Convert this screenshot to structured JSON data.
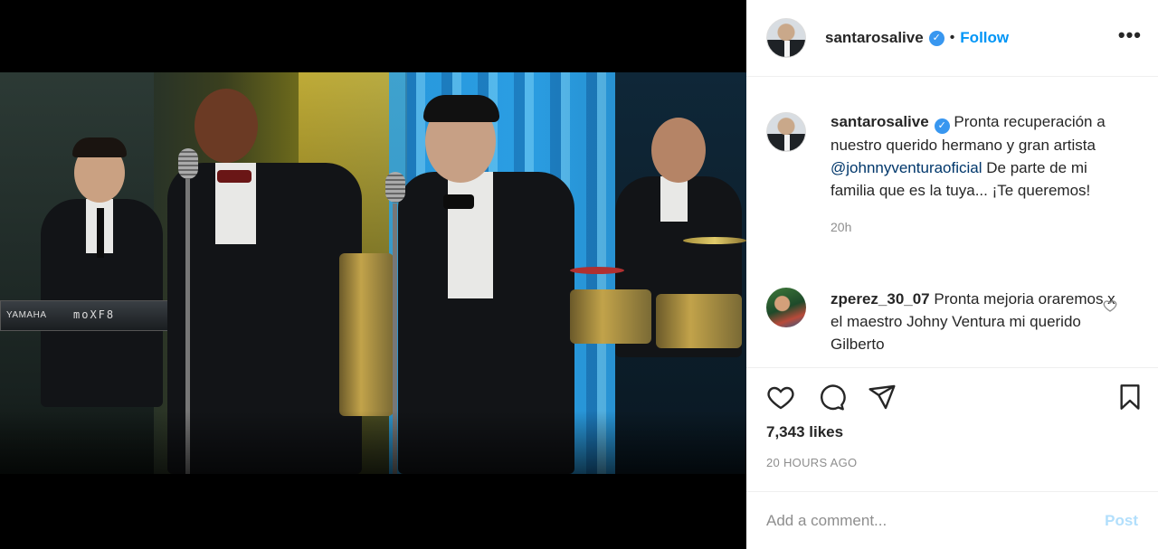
{
  "post": {
    "media": {
      "keyboard_brand": "YAMAHA",
      "keyboard_model": "moXF8"
    }
  },
  "header": {
    "username": "santarosalive",
    "verified_icon": "✓",
    "separator": "•",
    "follow_label": "Follow",
    "more_icon": "•••"
  },
  "caption": {
    "username": "santarosalive",
    "verified_icon": "✓",
    "text_before": "Pronta recuperación a nuestro querido hermano y gran artista ",
    "mention": "@johnnyventuraoficial",
    "text_after": " De parte de mi familia que es la tuya... ¡Te queremos!",
    "time": "20h"
  },
  "comments": [
    {
      "username": "zperez_30_07",
      "text": "Pronta mejoria oraremos x el maestro Johny Ventura mi querido Gilberto"
    }
  ],
  "likes": "7,343 likes",
  "timestamp": "20 HOURS AGO",
  "add_comment": {
    "placeholder": "Add a comment...",
    "post_label": "Post"
  },
  "colors": {
    "accent": "#0095f6",
    "verified": "#3897f0",
    "muted": "#8e8e8e",
    "post_disabled": "#b2dffc"
  },
  "icons": [
    "heart-icon",
    "comment-icon",
    "share-icon",
    "bookmark-icon",
    "verified-badge-icon",
    "more-options-icon"
  ]
}
